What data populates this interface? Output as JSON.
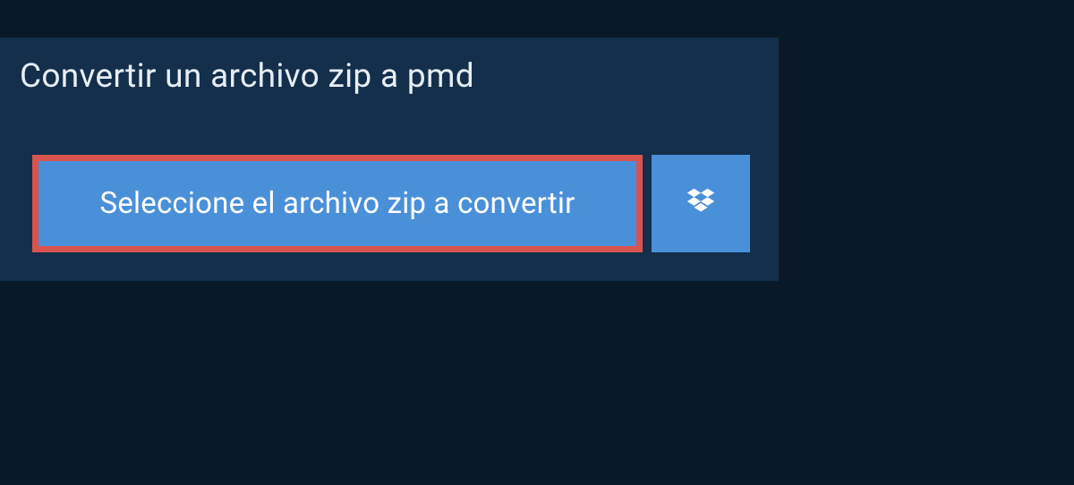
{
  "heading": "Convertir un archivo zip a pmd",
  "buttons": {
    "select_file_label": "Seleccione el archivo zip a convertir"
  },
  "colors": {
    "page_bg": "#0a1929",
    "panel_bg": "#132f4c",
    "button_bg": "#4a90d9",
    "button_border_highlight": "#d9534f",
    "text_light": "#e6eef5",
    "text_white": "#ffffff"
  }
}
